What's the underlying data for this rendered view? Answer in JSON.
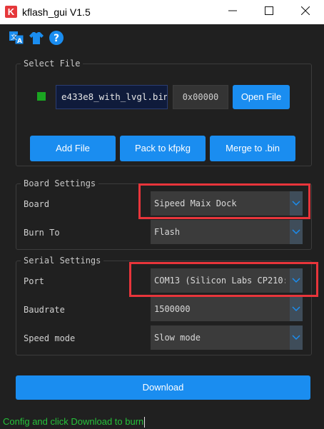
{
  "window": {
    "title": "kflash_gui V1.5",
    "logo_letter": "K"
  },
  "toolbar": {
    "icons": [
      "translate-icon",
      "shirt-icon",
      "help-icon"
    ]
  },
  "select_file": {
    "group_title": "Select File",
    "file_name": "e433e8_with_lvgl.bin",
    "address": "0x00000",
    "open_label": "Open File",
    "add_label": "Add File",
    "pack_label": "Pack to kfpkg",
    "merge_label": "Merge to .bin"
  },
  "board_settings": {
    "group_title": "Board Settings",
    "board_label": "Board",
    "board_value": "Sipeed Maix Dock",
    "burn_label": "Burn To",
    "burn_value": "Flash"
  },
  "serial_settings": {
    "group_title": "Serial Settings",
    "port_label": "Port",
    "port_value": "COM13 (Silicon Labs CP210:",
    "baud_label": "Baudrate",
    "baud_value": "1500000",
    "speed_label": "Speed mode",
    "speed_value": "Slow mode"
  },
  "download_label": "Download",
  "status": "Config and click Download to burn",
  "colors": {
    "accent": "#1a8df0",
    "highlight": "#e8353b",
    "status_text": "#25c23a"
  }
}
